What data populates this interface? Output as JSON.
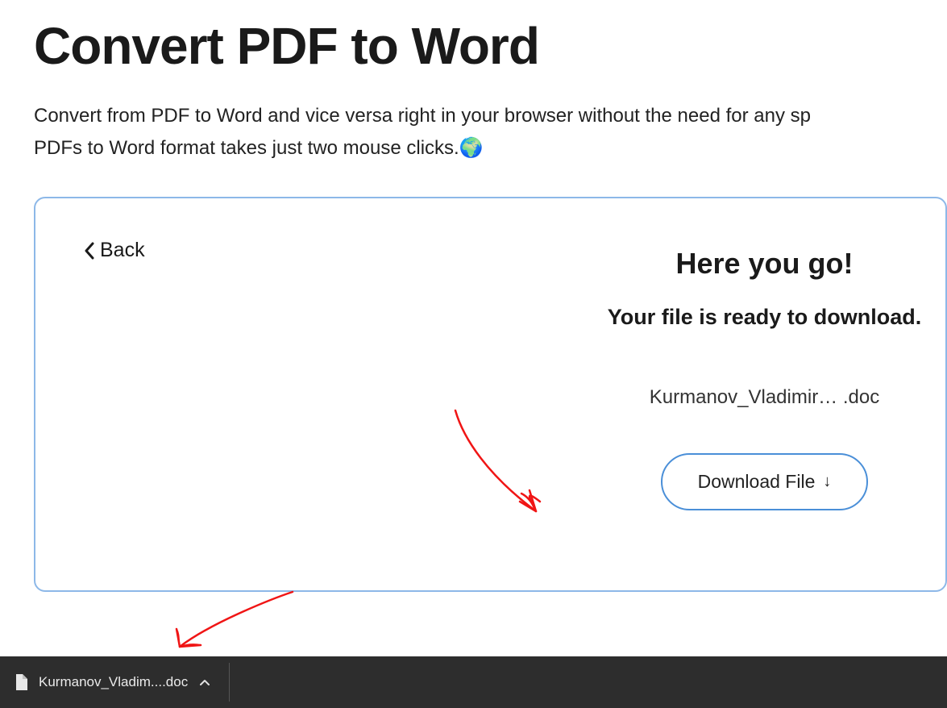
{
  "page": {
    "title": "Convert PDF to Word",
    "description_line1": "Convert from PDF to Word and vice versa right in your browser without the need for any sp",
    "description_line2": "PDFs to Word format takes just two mouse clicks.",
    "globe_emoji": "🌍"
  },
  "card": {
    "back_label": "Back",
    "result_title": "Here you go!",
    "result_subtitle": "Your file is ready to download.",
    "file_name": "Kurmanov_Vladimir…  .doc",
    "download_label": "Download File",
    "download_arrow": "↓"
  },
  "download_bar": {
    "item_name": "Kurmanov_Vladim....doc"
  }
}
